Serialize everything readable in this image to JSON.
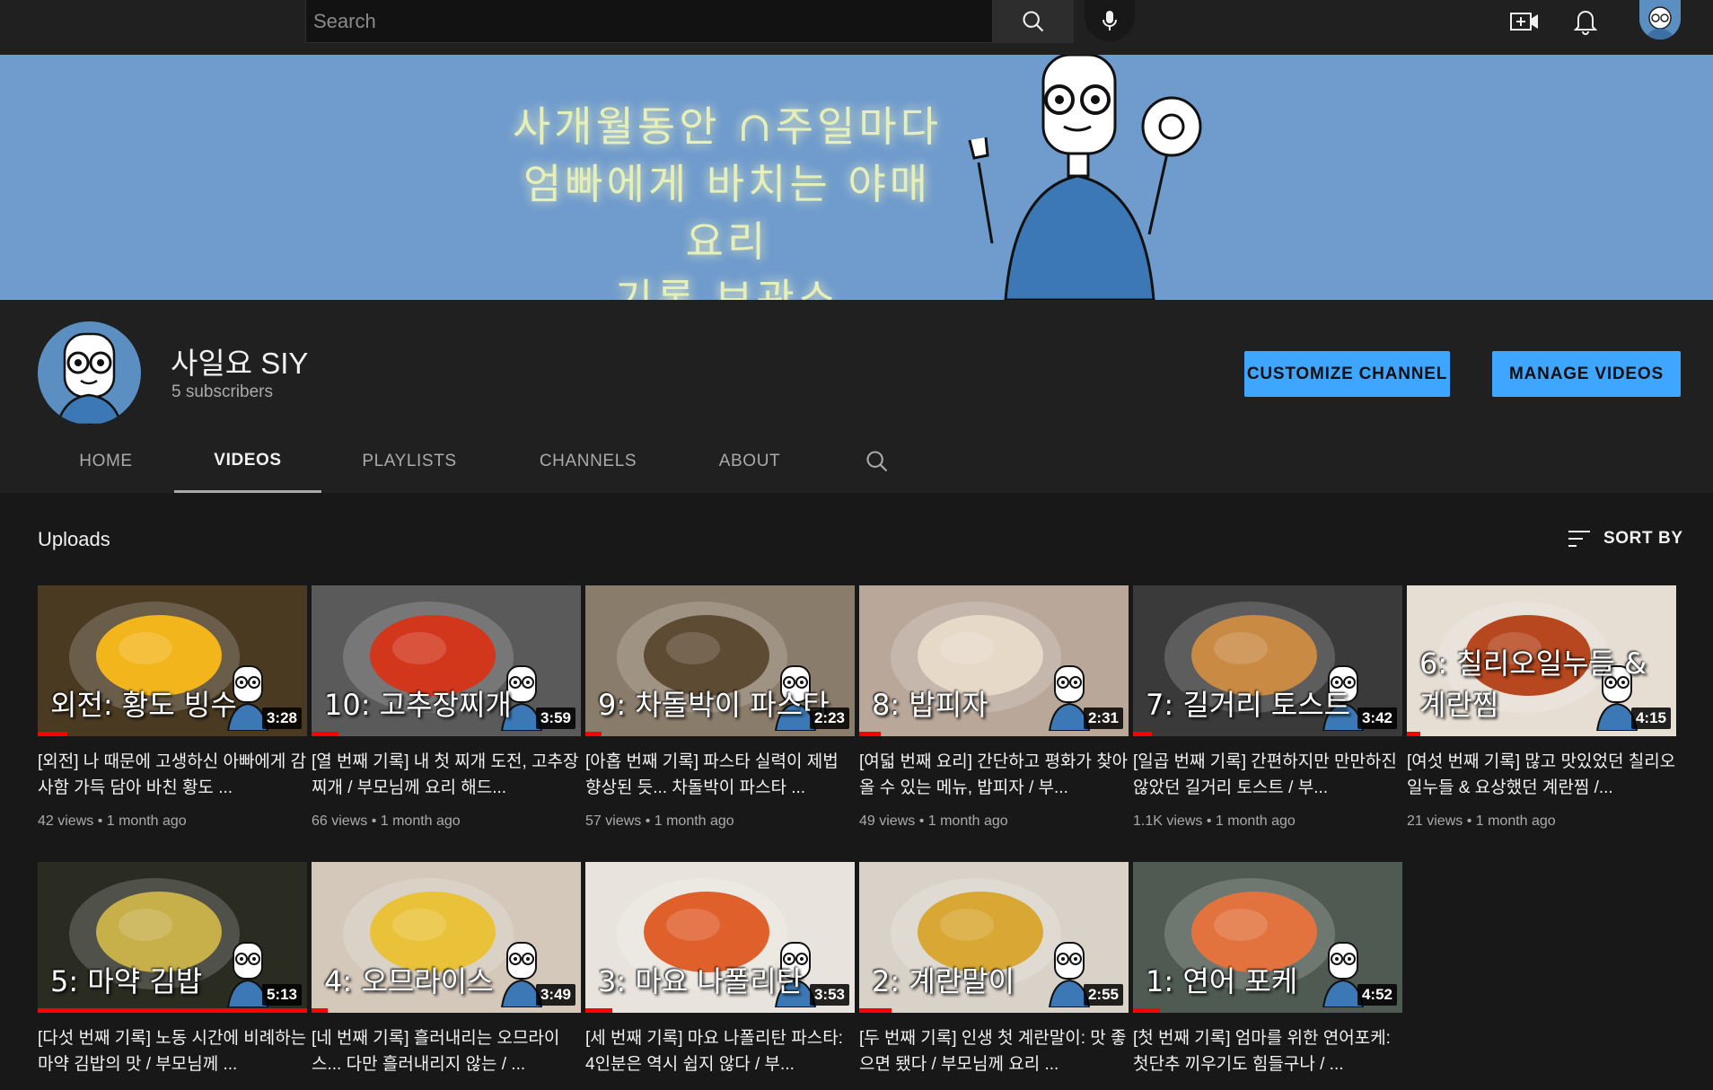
{
  "search": {
    "placeholder": "Search"
  },
  "icons": {
    "search": "search-icon",
    "mic": "microphone-icon",
    "create": "create-video-icon",
    "notifications": "bell-icon",
    "account": "account-avatar"
  },
  "banner": {
    "line1": "사개월동안 ∩주일마다",
    "line2": "엄빠에게 바치는 야매요리",
    "line3": "기록 보관소"
  },
  "channel": {
    "name": "사일요 SIY",
    "subscribers": "5 subscribers",
    "customize_label": "CUSTOMIZE CHANNEL",
    "manage_label": "MANAGE VIDEOS"
  },
  "tabs": {
    "home": "HOME",
    "videos": "VIDEOS",
    "playlists": "PLAYLISTS",
    "channels": "CHANNELS",
    "about": "ABOUT"
  },
  "uploads": {
    "title": "Uploads",
    "sort_label": "SORT BY"
  },
  "videos": [
    {
      "thumb_text": "외전: 황도 빙수",
      "duration": "3:28",
      "title": "[외전] 나 때문에 고생하신 아빠에게 감사함 가득 담아 바친 황도 ...",
      "meta": "42 views • 1 month ago",
      "bg": "#4a3a22",
      "accent": "#f2b51c"
    },
    {
      "thumb_text": "10: 고추장찌개",
      "duration": "3:59",
      "title": "[열 번째 기록] 내 첫 찌개 도전, 고추장찌개 / 부모님께 요리 해드...",
      "meta": "66 views • 1 month ago",
      "bg": "#5a5a5a",
      "accent": "#d2371c"
    },
    {
      "thumb_text": "9: 차돌박이 파스타",
      "duration": "2:23",
      "title": "[아홉 번째 기록] 파스타 실력이 제법 향상된 듯... 차돌박이 파스타 ...",
      "meta": "57 views • 1 month ago",
      "bg": "#8a7c6a",
      "accent": "#5e4b33"
    },
    {
      "thumb_text": "8: 밥피자",
      "duration": "2:31",
      "title": "[여덟 번째 요리] 간단하고 평화가 찾아올 수 있는 메뉴, 밥피자 / 부...",
      "meta": "49 views • 1 month ago",
      "bg": "#b9a89a",
      "accent": "#e7d9c8"
    },
    {
      "thumb_text": "7: 길거리 토스트",
      "duration": "3:42",
      "title": "[일곱 번째 기록] 간편하지만 만만하진 않았던 길거리 토스트 / 부...",
      "meta": "1.1K views • 1 month ago",
      "bg": "#3a3a3a",
      "accent": "#c98a43"
    },
    {
      "thumb_text": "6: 칠리오일누들 & 계란찜",
      "duration": "4:15",
      "title": "[여섯 번째 기록] 많고 맛있었던 칠리오일누들 & 요상했던 계란찜 /...",
      "meta": "21 views • 1 month ago",
      "bg": "#e6ddd3",
      "accent": "#b7471f"
    },
    {
      "thumb_text": "5: 마약 김밥",
      "duration": "5:13",
      "title": "[다섯 번째 기록] 노동 시간에 비례하는 마약 김밥의 맛 / 부모님께 ...",
      "meta": "",
      "bg": "#2a2c22",
      "accent": "#c7b04a"
    },
    {
      "thumb_text": "4: 오므라이스",
      "duration": "3:49",
      "title": "[네 번째 기록] 흘러내리는 오므라이스... 다만 흘러내리지 않는 / ...",
      "meta": "",
      "bg": "#d4c8bb",
      "accent": "#e9c23a"
    },
    {
      "thumb_text": "3: 마요 나폴리탄",
      "duration": "3:53",
      "title": "[세 번째 기록] 마요 나폴리탄 파스타: 4인분은 역시 쉽지 않다 / 부...",
      "meta": "",
      "bg": "#e8e3dc",
      "accent": "#e0602c"
    },
    {
      "thumb_text": "2: 계란말이",
      "duration": "2:55",
      "title": "[두 번째 기록] 인생 첫 계란말이: 맛 좋으면 됐다 / 부모님께 요리 ...",
      "meta": "",
      "bg": "#d8d2c8",
      "accent": "#d9a733"
    },
    {
      "thumb_text": "1: 연어 포케",
      "duration": "4:52",
      "title": "[첫 번째 기록] 엄마를 위한 연어포케: 첫단추 끼우기도 힘들구나 / ...",
      "meta": "",
      "bg": "#4f5b52",
      "accent": "#e2733e"
    }
  ],
  "progress": [
    0.11,
    0.1,
    0.06,
    0.08,
    0.07,
    0.05,
    1.0,
    0.06,
    0.1,
    0.12,
    0.1
  ]
}
